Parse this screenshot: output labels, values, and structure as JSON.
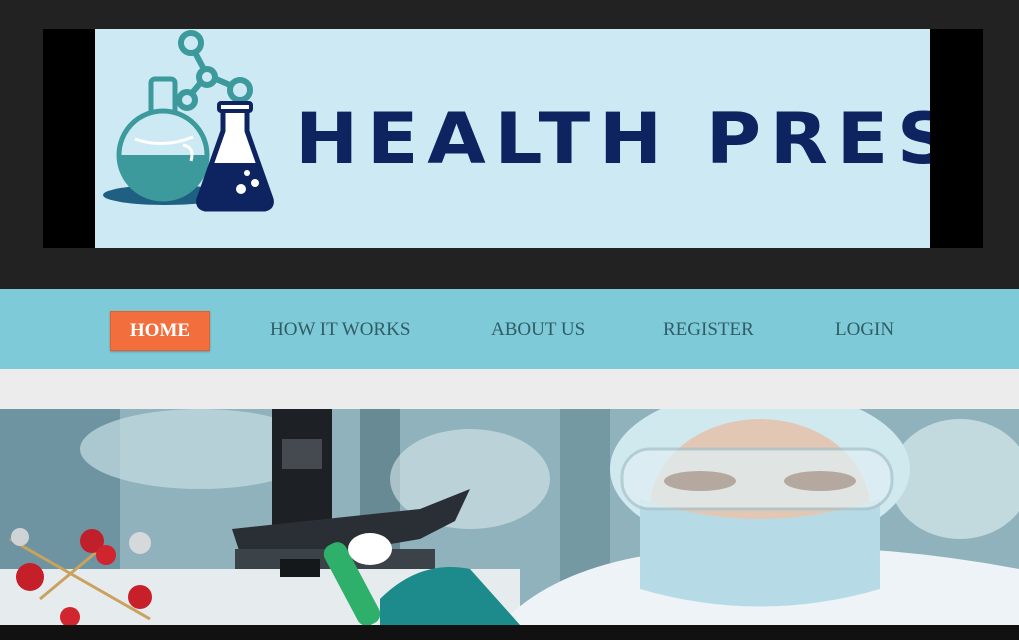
{
  "brand": {
    "title": "HEALTH PRESS",
    "logo_icon": "lab-flasks-molecule-icon",
    "colors": {
      "logo_text": "#0d2460",
      "logo_bg": "#cdeaf4",
      "flask_teal": "#3d9a9c",
      "flask_navy": "#0d2460"
    }
  },
  "nav": {
    "items": [
      {
        "label": "HOME",
        "active": true
      },
      {
        "label": "HOW IT WORKS",
        "active": false
      },
      {
        "label": "ABOUT US",
        "active": false
      },
      {
        "label": "REGISTER",
        "active": false
      },
      {
        "label": "LOGIN",
        "active": false
      }
    ],
    "colors": {
      "bar": "#7fcad9",
      "active_bg": "#f36e3d",
      "text": "#2f5d64"
    }
  },
  "hero": {
    "image": "lab-scientist-with-microscope-photo"
  }
}
